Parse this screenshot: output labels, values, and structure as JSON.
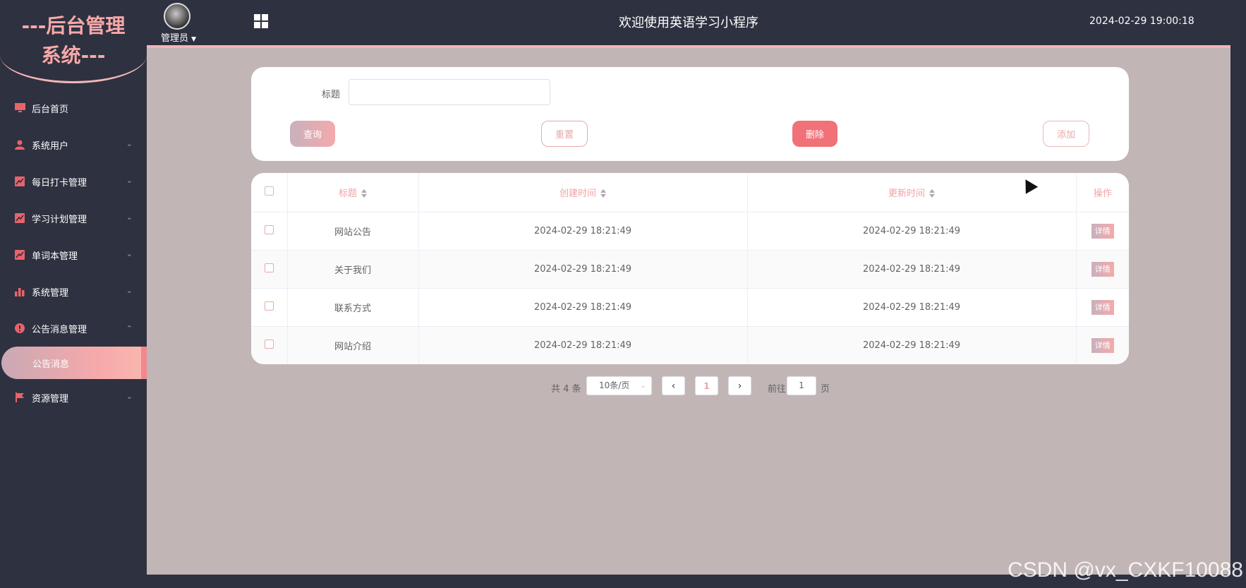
{
  "sidebar": {
    "logo_line1": "---后台管理",
    "logo_line2": "系统---",
    "items": [
      {
        "label": "后台首页",
        "icon": "monitor-icon",
        "expand": false
      },
      {
        "label": "系统用户",
        "icon": "user-icon",
        "expand": true
      },
      {
        "label": "每日打卡管理",
        "icon": "chart-line-icon",
        "expand": true
      },
      {
        "label": "学习计划管理",
        "icon": "chart-line-icon",
        "expand": true
      },
      {
        "label": "单词本管理",
        "icon": "chart-line-icon",
        "expand": true
      },
      {
        "label": "系统管理",
        "icon": "bar-chart-icon",
        "expand": true
      },
      {
        "label": "公告消息管理",
        "icon": "info-icon",
        "expand": true,
        "expanded": true,
        "sub": [
          {
            "label": "公告消息",
            "active": true
          }
        ]
      },
      {
        "label": "资源管理",
        "icon": "flag-icon",
        "expand": true
      }
    ]
  },
  "header": {
    "user_name": "管理员",
    "title": "欢迎使用英语学习小程序",
    "datetime": "2024-02-29 19:00:18"
  },
  "search": {
    "label": "标题",
    "value": "",
    "query_label": "查询",
    "reset_label": "重置",
    "delete_label": "删除",
    "add_label": "添加"
  },
  "table": {
    "columns": [
      "标题",
      "创建时间",
      "更新时间",
      "操作"
    ],
    "rows": [
      {
        "title": "网站公告",
        "created": "2024-02-29 18:21:49",
        "updated": "2024-02-29 18:21:49",
        "action": "详情"
      },
      {
        "title": "关于我们",
        "created": "2024-02-29 18:21:49",
        "updated": "2024-02-29 18:21:49",
        "action": "详情"
      },
      {
        "title": "联系方式",
        "created": "2024-02-29 18:21:49",
        "updated": "2024-02-29 18:21:49",
        "action": "详情"
      },
      {
        "title": "网站介绍",
        "created": "2024-02-29 18:21:49",
        "updated": "2024-02-29 18:21:49",
        "action": "详情"
      }
    ]
  },
  "pagination": {
    "total": "共 4 条",
    "page_size": "10条/页",
    "current": "1",
    "goto_label": "前往",
    "goto_value": "1",
    "page_suffix": "页"
  },
  "watermark": "CSDN @vx_CXKF10088",
  "colors": {
    "sidebar_bg": "#2e3140",
    "accent_pink": "#f1a2a5",
    "delete_red": "#f07178",
    "main_bg": "#c2b5b5"
  }
}
